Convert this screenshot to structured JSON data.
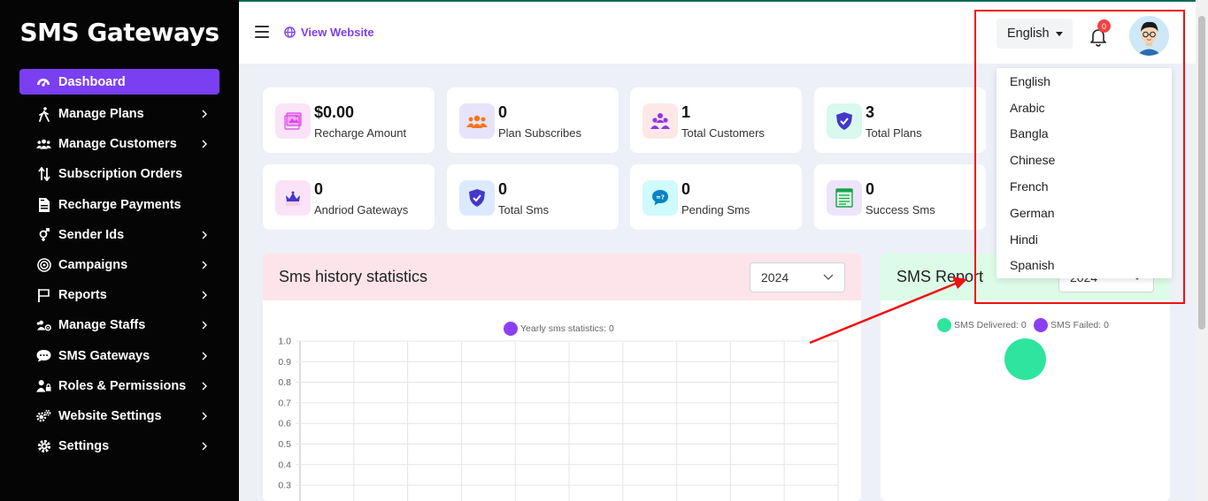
{
  "brand": "SMS Gateways",
  "sidebar": {
    "items": [
      {
        "label": "Dashboard",
        "icon": "dashboard-icon"
      },
      {
        "label": "Manage Plans",
        "icon": "walking-icon"
      },
      {
        "label": "Manage Customers",
        "icon": "users-icon"
      },
      {
        "label": "Subscription Orders",
        "icon": "sort-icon"
      },
      {
        "label": "Recharge Payments",
        "icon": "file-invoice-icon"
      },
      {
        "label": "Sender Ids",
        "icon": "venus-mars-icon"
      },
      {
        "label": "Campaigns",
        "icon": "bullseye-icon"
      },
      {
        "label": "Reports",
        "icon": "flag-icon"
      },
      {
        "label": "Manage Staffs",
        "icon": "users-cog-icon"
      },
      {
        "label": "SMS Gateways",
        "icon": "chat-icon"
      },
      {
        "label": "Roles & Permissions",
        "icon": "user-lock-icon"
      },
      {
        "label": "Website Settings",
        "icon": "cogs-icon"
      },
      {
        "label": "Settings",
        "icon": "gear-icon"
      }
    ]
  },
  "topbar": {
    "view_website": "View Website",
    "language": "English",
    "notification_count": "0"
  },
  "stats": [
    {
      "value": "$0.00",
      "label": "Recharge Amount"
    },
    {
      "value": "0",
      "label": "Plan Subscribes"
    },
    {
      "value": "1",
      "label": "Total Customers"
    },
    {
      "value": "3",
      "label": "Total Plans"
    },
    {
      "value": "0",
      "label": "Andriod Gateways"
    },
    {
      "value": "0",
      "label": "Total Sms"
    },
    {
      "value": "0",
      "label": "Pending Sms"
    },
    {
      "value": "0",
      "label": "Success Sms"
    }
  ],
  "history_panel": {
    "title": "Sms history statistics",
    "year": "2024",
    "legend": "Yearly sms statistics: 0"
  },
  "report_panel": {
    "title": "SMS Report",
    "year": "2024",
    "legend_delivered": "SMS Delivered: 0",
    "legend_failed": "SMS Failed: 0"
  },
  "language_dropdown": {
    "options": [
      "English",
      "Arabic",
      "Bangla",
      "Chinese",
      "French",
      "German",
      "Hindi",
      "Spanish"
    ]
  },
  "colors": {
    "accent": "#7b3ff2",
    "delivered": "#2ee59d",
    "failed": "#8b3ff2",
    "history_header": "#fde4ea",
    "report_header": "#dcfce7",
    "annotation": "#ee1111"
  },
  "chart_data": {
    "type": "line",
    "legend": "Yearly sms statistics: 0",
    "yticks": [
      1.0,
      0.9,
      0.8,
      0.7,
      0.6,
      0.5,
      0.4,
      0.3
    ],
    "ylim": [
      0,
      1.0
    ],
    "grid": true,
    "series": [
      {
        "name": "Yearly sms statistics: 0",
        "values": []
      }
    ]
  }
}
